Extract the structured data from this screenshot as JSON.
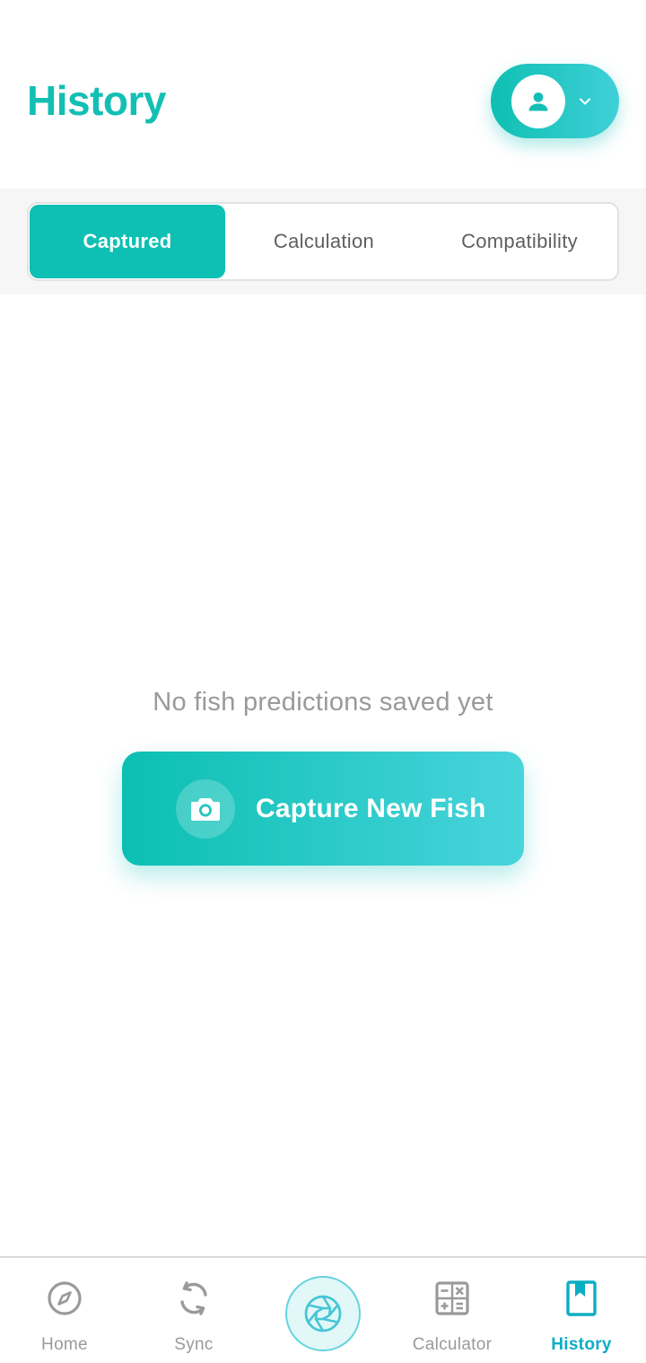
{
  "header": {
    "title": "History",
    "profile_menu_icon": "person-icon",
    "dropdown_icon": "chevron-down-icon"
  },
  "tabs": [
    {
      "label": "Captured",
      "active": true
    },
    {
      "label": "Calculation",
      "active": false
    },
    {
      "label": "Compatibility",
      "active": false
    }
  ],
  "empty_state": {
    "message": "No fish predictions saved yet",
    "button_label": "Capture New Fish",
    "button_icon": "camera-icon"
  },
  "bottom_nav": {
    "items": [
      {
        "label": "Home",
        "icon": "compass-icon",
        "active": false
      },
      {
        "label": "Sync",
        "icon": "sync-icon",
        "active": false
      },
      {
        "label": "",
        "icon": "aperture-icon",
        "active": false
      },
      {
        "label": "Calculator",
        "icon": "calculator-icon",
        "active": false
      },
      {
        "label": "History",
        "icon": "bookmark-book-icon",
        "active": true
      }
    ]
  },
  "colors": {
    "accent": "#13bfb4",
    "accent_light": "#48d4dc",
    "active_nav": "#0aaec4",
    "muted_text": "#999999"
  }
}
